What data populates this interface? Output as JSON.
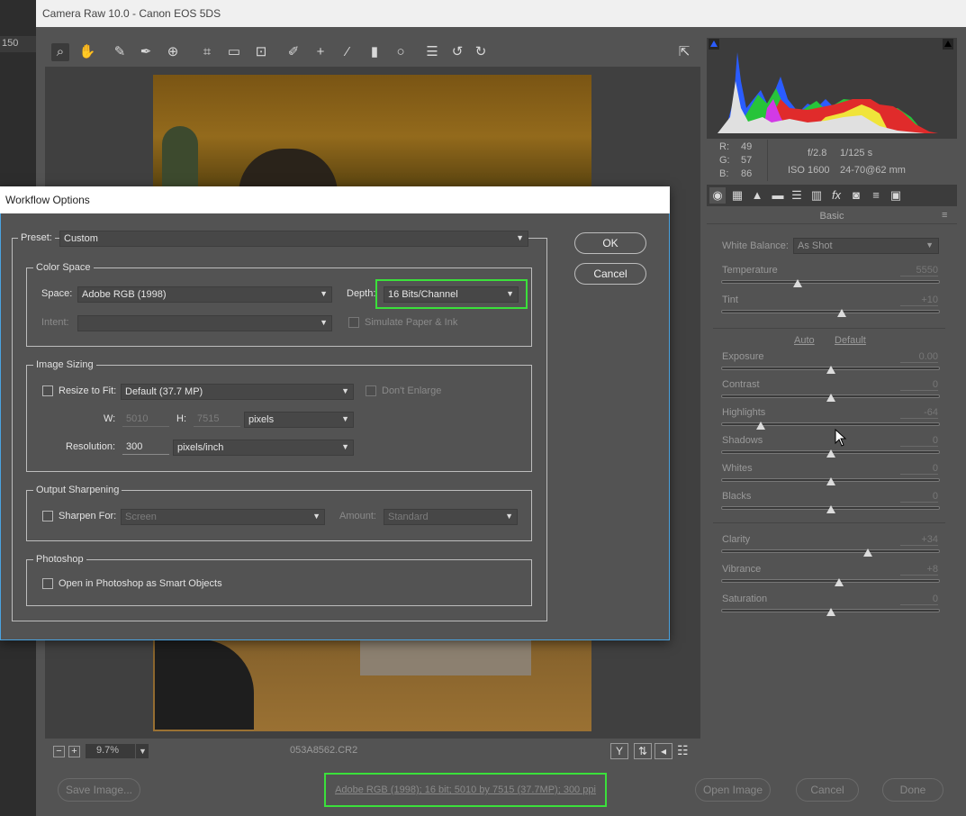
{
  "app": {
    "title": "Camera Raw 10.0  -  Canon EOS 5DS",
    "ruler_value": "150"
  },
  "toolbar": {
    "tools": [
      "zoom-icon",
      "hand-icon",
      "white-balance-icon",
      "color-sampler-icon",
      "targeted-adjust-icon",
      "crop-icon",
      "straighten-icon",
      "transform-icon",
      "spot-removal-icon",
      "red-eye-icon",
      "adjustment-brush-icon",
      "graduated-filter-icon",
      "radial-filter-icon",
      "list-icon",
      "rotate-ccw-icon",
      "rotate-cw-icon"
    ]
  },
  "photo_bar": {
    "zoom": "9.7%",
    "filename": "053A8562.CR2"
  },
  "histogram": {
    "r_label": "R:",
    "g_label": "G:",
    "b_label": "B:",
    "r": "49",
    "g": "57",
    "b": "86",
    "aperture": "f/2.8",
    "shutter": "1/125 s",
    "iso": "ISO 1600",
    "lens": "24-70@62 mm"
  },
  "panel": {
    "section": "Basic",
    "white_balance_label": "White Balance:",
    "white_balance": "As Shot",
    "auto": "Auto",
    "default": "Default",
    "sliders": [
      {
        "label": "Temperature",
        "value": "5550",
        "pos": 0.35
      },
      {
        "label": "Tint",
        "value": "+10",
        "pos": 0.55
      },
      {
        "label": "Exposure",
        "value": "0.00",
        "pos": 0.5
      },
      {
        "label": "Contrast",
        "value": "0",
        "pos": 0.5
      },
      {
        "label": "Highlights",
        "value": "-64",
        "pos": 0.18
      },
      {
        "label": "Shadows",
        "value": "0",
        "pos": 0.5
      },
      {
        "label": "Whites",
        "value": "0",
        "pos": 0.5
      },
      {
        "label": "Blacks",
        "value": "0",
        "pos": 0.5
      },
      {
        "label": "Clarity",
        "value": "+34",
        "pos": 0.67
      },
      {
        "label": "Vibrance",
        "value": "+8",
        "pos": 0.54
      },
      {
        "label": "Saturation",
        "value": "0",
        "pos": 0.5
      }
    ]
  },
  "bottom": {
    "save": "Save Image...",
    "workflow": "Adobe RGB (1998); 16 bit; 5010 by 7515 (37.7MP); 300 ppi",
    "open": "Open Image",
    "cancel": "Cancel",
    "done": "Done"
  },
  "dialog": {
    "title": "Workflow Options",
    "preset_label": "Preset:",
    "preset": "Custom",
    "ok": "OK",
    "cancel": "Cancel",
    "color_space": {
      "title": "Color Space",
      "space_label": "Space:",
      "space": "Adobe RGB (1998)",
      "depth_label": "Depth:",
      "depth": "16 Bits/Channel",
      "intent_label": "Intent:",
      "intent": "",
      "simulate": "Simulate Paper & Ink"
    },
    "image_sizing": {
      "title": "Image Sizing",
      "resize_label": "Resize to Fit:",
      "resize": "Default  (37.7 MP)",
      "dont_enlarge": "Don't Enlarge",
      "w_label": "W:",
      "w": "5010",
      "h_label": "H:",
      "h": "7515",
      "unit": "pixels",
      "resolution_label": "Resolution:",
      "resolution": "300",
      "res_unit": "pixels/inch"
    },
    "sharpening": {
      "title": "Output Sharpening",
      "sharpen_label": "Sharpen For:",
      "sharpen": "Screen",
      "amount_label": "Amount:",
      "amount": "Standard"
    },
    "photoshop": {
      "title": "Photoshop",
      "smart": "Open in Photoshop as Smart Objects"
    }
  }
}
